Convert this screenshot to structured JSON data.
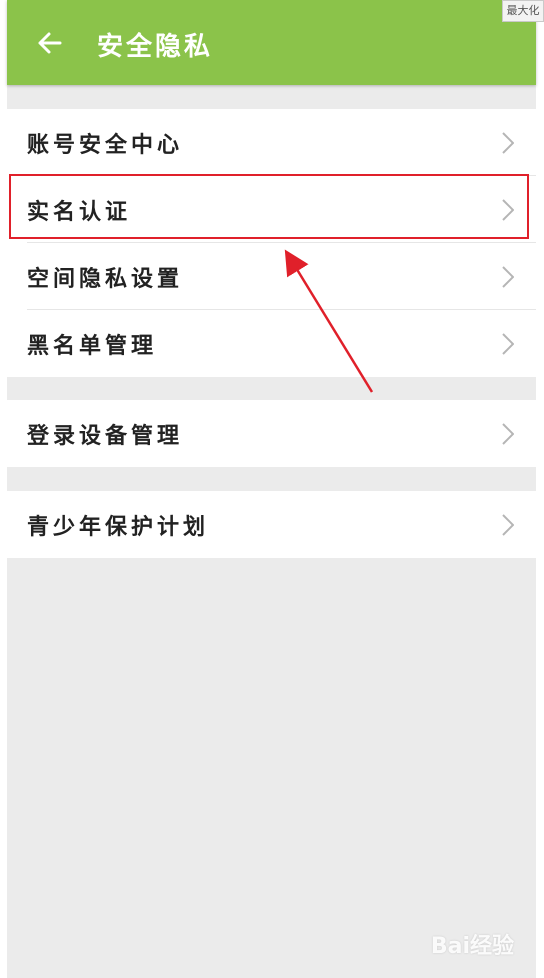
{
  "window": {
    "maximize_label": "最大化"
  },
  "header": {
    "title": "安全隐私"
  },
  "groups": [
    {
      "items": [
        {
          "label": "账号安全中心"
        },
        {
          "label": "实名认证"
        },
        {
          "label": "空间隐私设置"
        },
        {
          "label": "黑名单管理"
        }
      ]
    },
    {
      "items": [
        {
          "label": "登录设备管理"
        }
      ]
    },
    {
      "items": [
        {
          "label": "青少年保护计划"
        }
      ]
    }
  ],
  "annotation": {
    "highlight_color": "#e0202a"
  },
  "watermark": {
    "text": "Bai经验"
  },
  "colors": {
    "header_bg": "#8bc34a",
    "page_bg": "#ebebeb"
  }
}
